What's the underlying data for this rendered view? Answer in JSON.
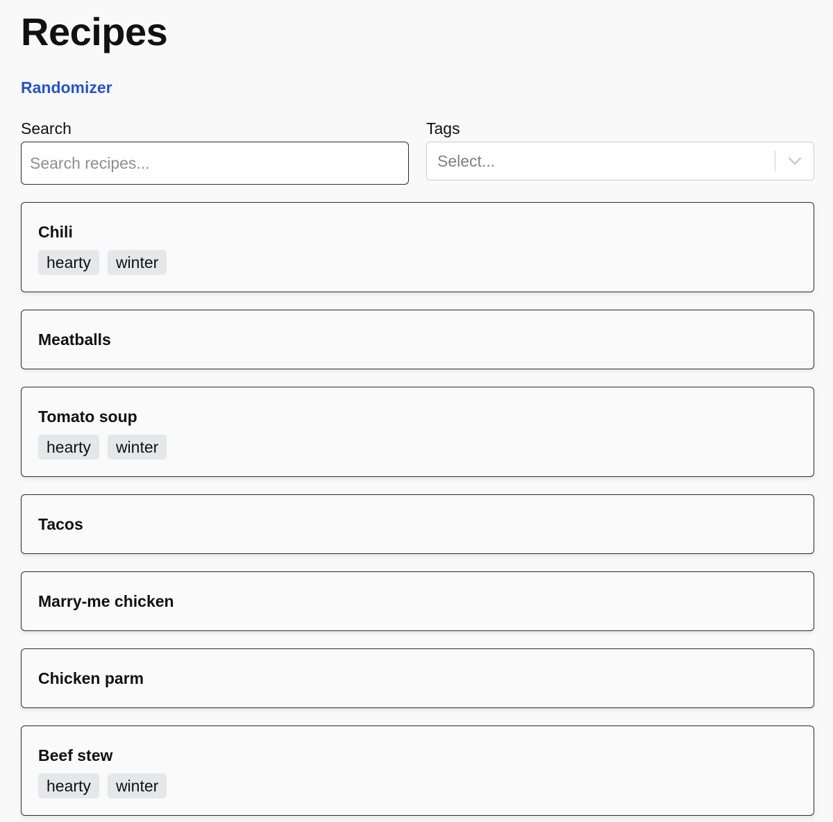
{
  "page": {
    "title": "Recipes",
    "randomizer_link": "Randomizer",
    "link_color": "#2352d8"
  },
  "filters": {
    "search": {
      "label": "Search",
      "placeholder": "Search recipes...",
      "value": ""
    },
    "tags": {
      "label": "Tags",
      "placeholder": "Select...",
      "icon": "chevron-down-icon"
    }
  },
  "recipes": [
    {
      "name": "Chili",
      "tags": [
        "hearty",
        "winter"
      ]
    },
    {
      "name": "Meatballs",
      "tags": []
    },
    {
      "name": "Tomato soup",
      "tags": [
        "hearty",
        "winter"
      ]
    },
    {
      "name": "Tacos",
      "tags": []
    },
    {
      "name": "Marry-me chicken",
      "tags": []
    },
    {
      "name": "Chicken parm",
      "tags": []
    },
    {
      "name": "Beef stew",
      "tags": [
        "hearty",
        "winter"
      ]
    }
  ]
}
